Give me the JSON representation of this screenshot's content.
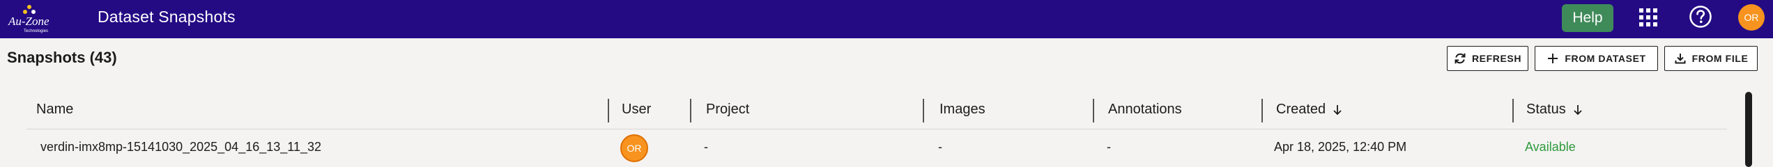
{
  "header": {
    "logo_text": "Au-Zone",
    "logo_subtext": "Technologies",
    "app_title": "Dataset Snapshots",
    "help_label": "Help",
    "apps_icon": "grid-apps-icon",
    "help_icon": "question-circle-icon",
    "user_initials": "OR",
    "colors": {
      "bar": "#240b84",
      "help_button": "#3f8a59",
      "avatar": "#f7931e"
    }
  },
  "page": {
    "heading": "Snapshots (43)",
    "actions": {
      "refresh_label": "REFRESH",
      "from_dataset_label": "FROM DATASET",
      "from_file_label": "FROM FILE"
    }
  },
  "table": {
    "columns": {
      "name": "Name",
      "user": "User",
      "project": "Project",
      "images": "Images",
      "annotations": "Annotations",
      "created": "Created",
      "status": "Status"
    },
    "rows": [
      {
        "name": "verdin-imx8mp-15141030_2025_04_16_13_11_32",
        "user": "OR",
        "project": "-",
        "images": "-",
        "annotations": "-",
        "created": "Apr 18, 2025, 12:40 PM",
        "status": "Available"
      }
    ],
    "status_color": "#2e9b3c"
  }
}
